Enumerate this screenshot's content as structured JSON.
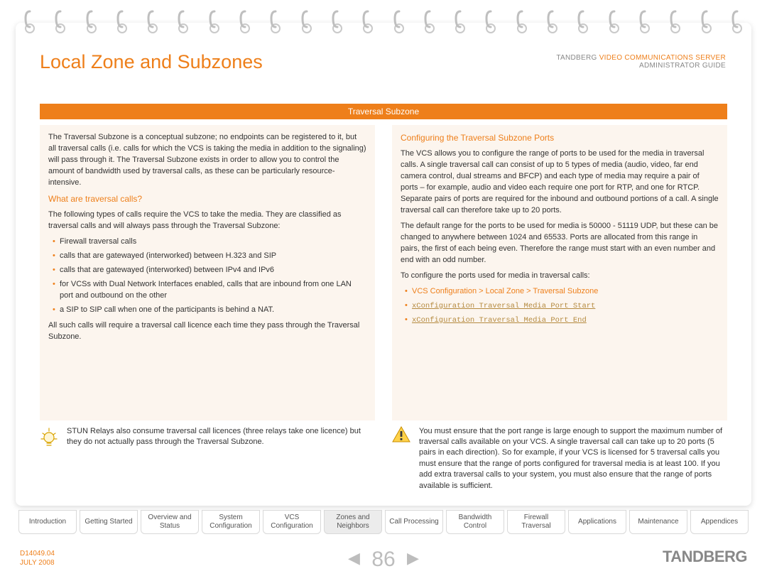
{
  "header": {
    "title": "Local Zone and Subzones",
    "brand": "TANDBERG",
    "product": "VIDEO COMMUNICATIONS SERVER",
    "subtitle": "ADMINISTRATOR GUIDE"
  },
  "banner": "Traversal Subzone",
  "left": {
    "intro": "The Traversal Subzone is a conceptual subzone; no endpoints can be registered to it, but all traversal calls (i.e. calls for which the VCS is taking the media in addition to the signaling) will pass through it.  The Traversal Subzone exists in order to allow you to control the amount of bandwidth used by traversal calls, as these can be particularly resource-intensive.",
    "q_heading": "What are traversal calls?",
    "q_intro": "The following types of calls require the VCS to take the media.  They are classified as traversal calls and will always pass through the Traversal Subzone:",
    "bullets": [
      "Firewall traversal calls",
      "calls that are gatewayed (interworked) between H.323 and SIP",
      "calls that are gatewayed (interworked) between IPv4 and IPv6",
      "for VCSs with Dual Network Interfaces enabled, calls that are inbound from one LAN port and outbound on the other",
      "a SIP to SIP call when one of the participants is behind a NAT."
    ],
    "after": "All such calls will require a traversal call licence each time they pass through the Traversal Subzone.",
    "note": "STUN Relays also consume traversal call licences (three relays take one licence) but they do not actually pass through the Traversal Subzone."
  },
  "right": {
    "heading": "Configuring the Traversal Subzone Ports",
    "p1": "The VCS allows you to configure the range of ports to be used for the media in traversal calls.  A single traversal call can consist of up to 5 types of media (audio, video, far end camera control, dual streams and BFCP) and each type of media may require a pair of ports – for example, audio and video each require one port for RTP, and one for RTCP.  Separate pairs of ports are required for the inbound and outbound portions of a call.  A single traversal call can therefore take up to 20 ports.",
    "p2": "The default range for the ports to be used for media is 50000 - 51119 UDP, but these can be changed to anywhere between 1024 and 65533. Ports are allocated from this range in pairs, the first of each being even. Therefore the range must start with an even number and end with an odd number.",
    "p3": "To configure the ports used for media in traversal calls:",
    "cfg_path": "VCS Configuration > Local Zone > Traversal Subzone",
    "cmd1": "xConfiguration Traversal Media Port Start",
    "cmd2": "xConfiguration Traversal Media Port End",
    "note": "You must ensure that the port range is large enough to support the maximum number of traversal calls available on your VCS.  A single traversal call can take up to 20 ports (5 pairs in each direction).  So for example, if your VCS is licensed for 5 traversal calls you must ensure that the range of ports configured for traversal media is at least 100.  If you add extra traversal calls to your system, you must also ensure that the range of ports available is sufficient."
  },
  "tabs": [
    "Introduction",
    "Getting Started",
    "Overview and Status",
    "System Configuration",
    "VCS Configuration",
    "Zones and Neighbors",
    "Call Processing",
    "Bandwidth Control",
    "Firewall Traversal",
    "Applications",
    "Maintenance",
    "Appendices"
  ],
  "active_tab_index": 5,
  "footer": {
    "doc_id": "D14049.04",
    "date": "JULY 2008",
    "page": "86",
    "logo": "TANDBERG"
  }
}
